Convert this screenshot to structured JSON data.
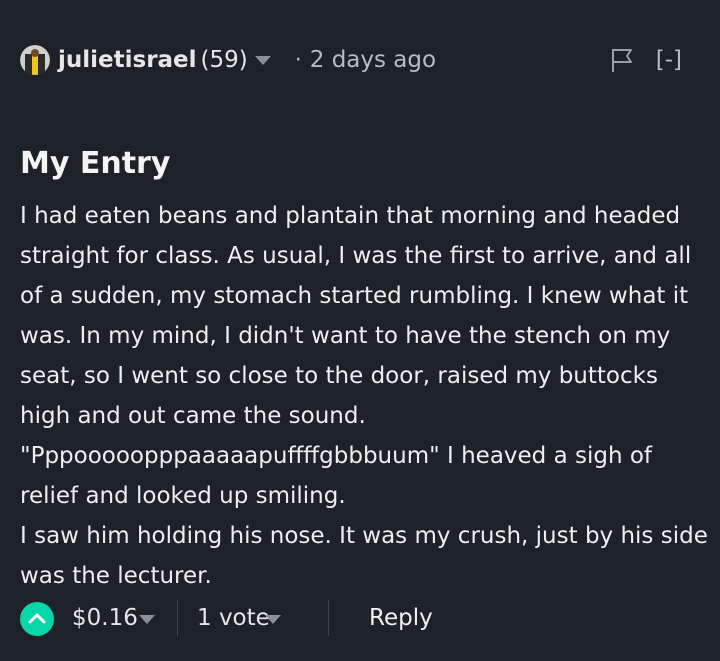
{
  "comment": {
    "author": "julietisrael",
    "reputation": "(59)",
    "separator": "·",
    "timestamp": "2 days ago",
    "collapse_label": "[-]",
    "title": "My Entry",
    "body_lines": [
      "I had eaten beans and plantain that morning and headed",
      "straight for class. As usual, I was the first to arrive, and all",
      "of a sudden, my stomach started rumbling. I knew what it",
      "was. In my mind, I didn't want to have the stench on my",
      "seat, so I went so close to the door, raised my buttocks",
      "high and out came the sound.",
      "\"Pppooooopppaaaaapuffffgbbbuum\" I heaved a sigh of",
      "relief and looked up smiling.",
      "I saw him holding his nose. It was my crush, just by his side",
      "was the lecturer."
    ],
    "payout": "$0.16",
    "votes": "1 vote",
    "reply_label": "Reply"
  },
  "icons": {
    "avatar": "avatar-icon",
    "author_menu": "chevron-down-icon",
    "flag": "flag-icon",
    "upvote": "upvote-chevron-icon",
    "payout_menu": "chevron-down-icon",
    "votes_menu": "chevron-down-icon"
  },
  "colors": {
    "background": "#1c2227",
    "text": "#eeeeee",
    "muted": "#b8bcc0",
    "upvote_accent": "#06d6a9"
  }
}
